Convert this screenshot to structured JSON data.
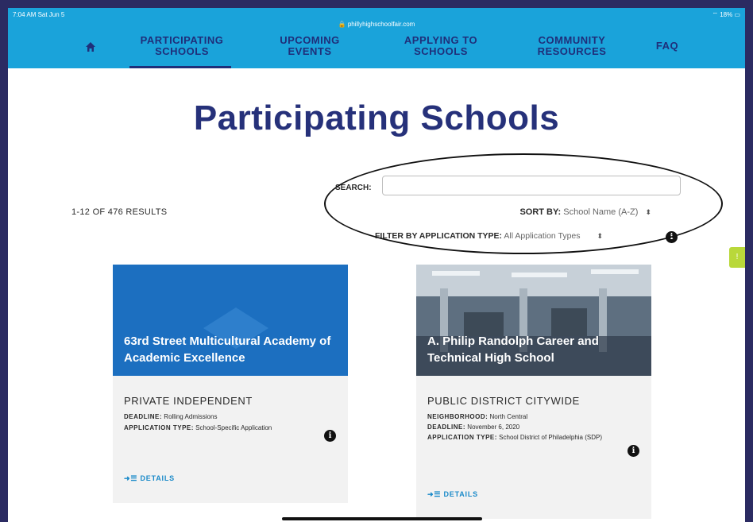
{
  "status_bar": {
    "time": "7:04 AM  Sat Jun 5",
    "url": "🔒 phillyhighschoolfair.com",
    "battery": "⌔ 18% ▭"
  },
  "nav": {
    "items": [
      {
        "line1": "PARTICIPATING",
        "line2": "SCHOOLS"
      },
      {
        "line1": "UPCOMING",
        "line2": "EVENTS"
      },
      {
        "line1": "APPLYING TO",
        "line2": "SCHOOLS"
      },
      {
        "line1": "COMMUNITY",
        "line2": "RESOURCES"
      },
      {
        "line1": "FAQ",
        "line2": ""
      }
    ],
    "home_icon": "home-icon"
  },
  "page": {
    "title": "Participating Schools",
    "results": "1-12 OF 476 RESULTS",
    "search_label": "SEARCH:",
    "search_value": "",
    "sort_label": "SORT BY:",
    "sort_value": "School Name (A-Z)",
    "filter_label": "FILTER BY APPLICATION TYPE:",
    "filter_value": "All Application Types",
    "info_glyph": "i",
    "select_glyph": "⬍"
  },
  "cards": [
    {
      "name": "63rd Street Multicultural Academy of Academic Excellence",
      "type": "PRIVATE INDEPENDENT",
      "details": [
        {
          "label": "DEADLINE:",
          "value": "Rolling Admissions"
        },
        {
          "label": "APPLICATION TYPE:",
          "value": "School-Specific Application"
        }
      ],
      "link": "➜☰ DETAILS"
    },
    {
      "name": "A. Philip Randolph Career and Technical High School",
      "type": "PUBLIC DISTRICT CITYWIDE",
      "details": [
        {
          "label": "NEIGHBORHOOD:",
          "value": "North Central"
        },
        {
          "label": "DEADLINE:",
          "value": "November 6, 2020"
        },
        {
          "label": "APPLICATION TYPE:",
          "value": "School District of Philadelphia (SDP)"
        }
      ],
      "link": "➜☰ DETAILS"
    }
  ],
  "feedback_tab": "!",
  "colors": {
    "nav_bg": "#1aa3da",
    "title": "#26317a",
    "card1_hero": "#1c6fc0",
    "link": "#1a8ac9",
    "frame": "#2b2b62"
  }
}
